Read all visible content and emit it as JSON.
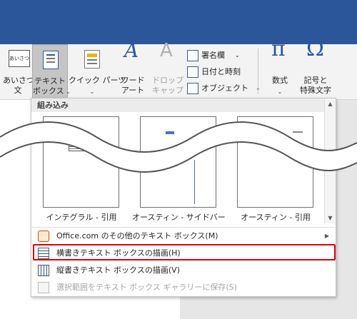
{
  "ribbon": {
    "greeting": {
      "label": "あいさつ\n文",
      "icon_text": "あいさつ"
    },
    "textbox": {
      "label": "テキスト\nボックス"
    },
    "quickparts": {
      "label": "クイック パーツ"
    },
    "wordart": {
      "label": "ワード\nアート"
    },
    "dropcap": {
      "label": "ドロップ\nキャップ"
    },
    "signature": {
      "label": "署名欄"
    },
    "datetime": {
      "label": "日付と時刻"
    },
    "object": {
      "label": "オブジェクト"
    },
    "equation": {
      "label": "数式",
      "icon": "π"
    },
    "symbol": {
      "label": "記号と\n特殊文字",
      "icon": "Ω"
    }
  },
  "panel": {
    "header": "組み込み",
    "thumbnails": [
      {
        "label": "インテグラル - 引用"
      },
      {
        "label": "オースティン - サイドバー"
      },
      {
        "label": "オースティン - 引用"
      }
    ],
    "menu": [
      {
        "label": "Office.com のその他のテキスト ボックス(M)",
        "has_submenu": true,
        "disabled": false
      },
      {
        "label": "横書きテキスト ボックスの描画(H)",
        "has_submenu": false,
        "disabled": false,
        "highlighted": true
      },
      {
        "label": "縦書きテキスト ボックスの描画(V)",
        "has_submenu": false,
        "disabled": false
      },
      {
        "label": "選択範囲をテキスト ボックス ギャラリーに保存(S)",
        "has_submenu": false,
        "disabled": true
      }
    ]
  },
  "colors": {
    "titlebar": "#2b579a",
    "highlight_border": "#e0000f",
    "accent_icon": "#2b579a"
  }
}
